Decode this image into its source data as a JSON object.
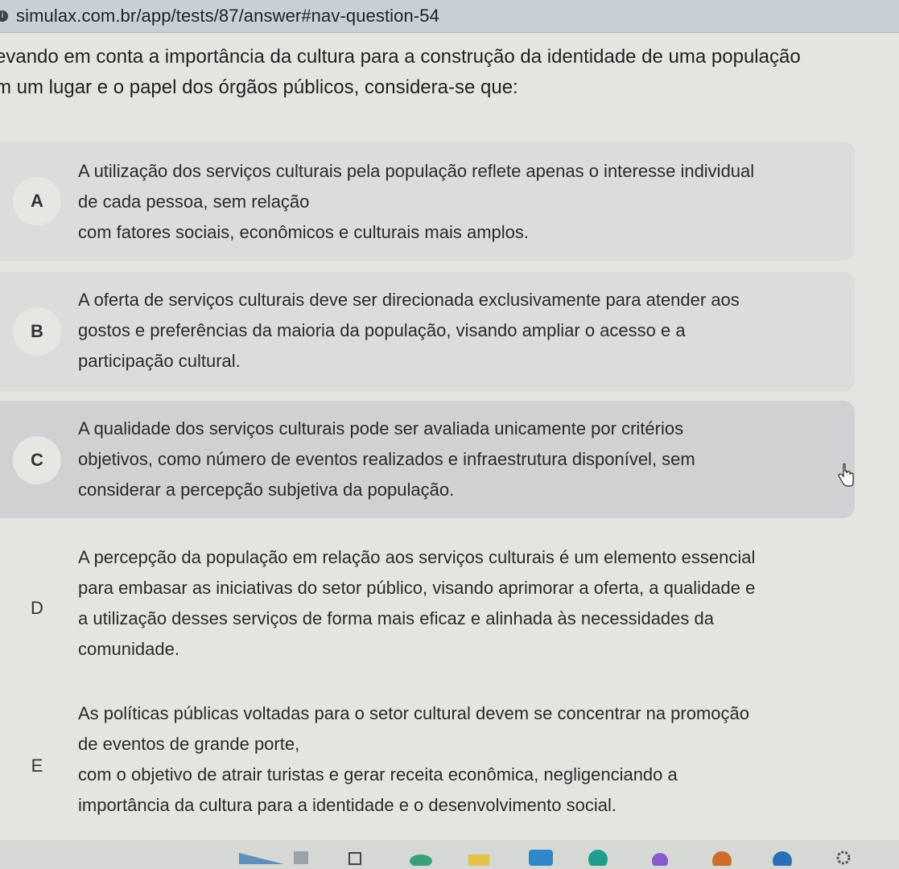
{
  "browser": {
    "url": "simulax.com.br/app/tests/87/answer#nav-question-54"
  },
  "question": {
    "line1": "evando em conta a importância da cultura para a construção da identidade de uma população",
    "line2": "m um lugar e o papel dos órgãos públicos, considera-se que:"
  },
  "options": [
    {
      "letter": "A",
      "lines": [
        "A utilização dos serviços culturais pela população reflete apenas o interesse individual",
        "de cada pessoa, sem relação",
        "com fatores sociais, econômicos e culturais mais amplos."
      ]
    },
    {
      "letter": "B",
      "lines": [
        "A oferta de serviços culturais deve ser direcionada exclusivamente para atender aos",
        "gostos e preferências da maioria da população, visando ampliar o acesso e a",
        "participação cultural."
      ]
    },
    {
      "letter": "C",
      "lines": [
        "A qualidade dos serviços culturais pode ser avaliada unicamente por critérios",
        "objetivos, como número de eventos realizados e infraestrutura disponível, sem",
        "considerar a percepção subjetiva da população."
      ]
    },
    {
      "letter": "D",
      "lines": [
        "A percepção da população em relação aos serviços culturais é um elemento essencial",
        "para embasar as iniciativas do setor público, visando aprimorar a oferta, a qualidade e",
        "a utilização desses serviços de forma mais eficaz e alinhada às necessidades da",
        "comunidade."
      ]
    },
    {
      "letter": "E",
      "lines": [
        "As políticas públicas voltadas para o setor cultural devem se concentrar na promoção",
        "de eventos de grande porte,",
        "com o objetivo de atrair turistas e gerar receita econômica, negligenciando a",
        "importância da cultura para a identidade e o desenvolvimento social."
      ]
    }
  ],
  "colors": {
    "hover_option": "#cfd1d3",
    "option_bg": "#dcdddb",
    "page_bg": "#e4e5e0"
  }
}
